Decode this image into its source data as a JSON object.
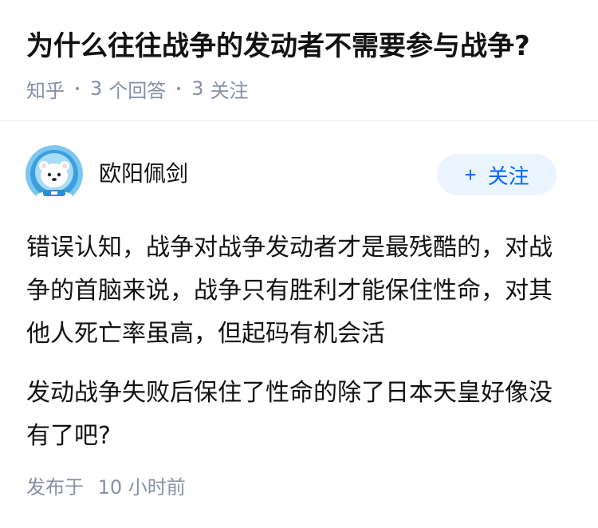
{
  "question": {
    "title": "为什么往往战争的发动者不需要参与战争?",
    "source": "知乎",
    "answers_count": "3",
    "answers_label": "个回答",
    "followers_count": "3",
    "followers_label": "关注"
  },
  "answer": {
    "author": {
      "name": "欧阳佩剑",
      "avatar_icon": "astronaut-avatar-icon"
    },
    "follow_button": {
      "plus": "+",
      "label": "关注"
    },
    "paragraphs": [
      "错误认知，战争对战争发动者才是最残酷的，对战争的首脑来说，战争只有胜利才能保住性命，对其他人死亡率虽高，但起码有机会活",
      "发动战争失败后保住了性命的除了日本天皇好像没有了吧?"
    ],
    "posted_label": "发布于",
    "posted_time": "10 小时前"
  },
  "colors": {
    "accent": "#0066ff",
    "accent_bg": "#ebf5ff",
    "meta_text": "#8590a6",
    "body_text": "#121212"
  }
}
